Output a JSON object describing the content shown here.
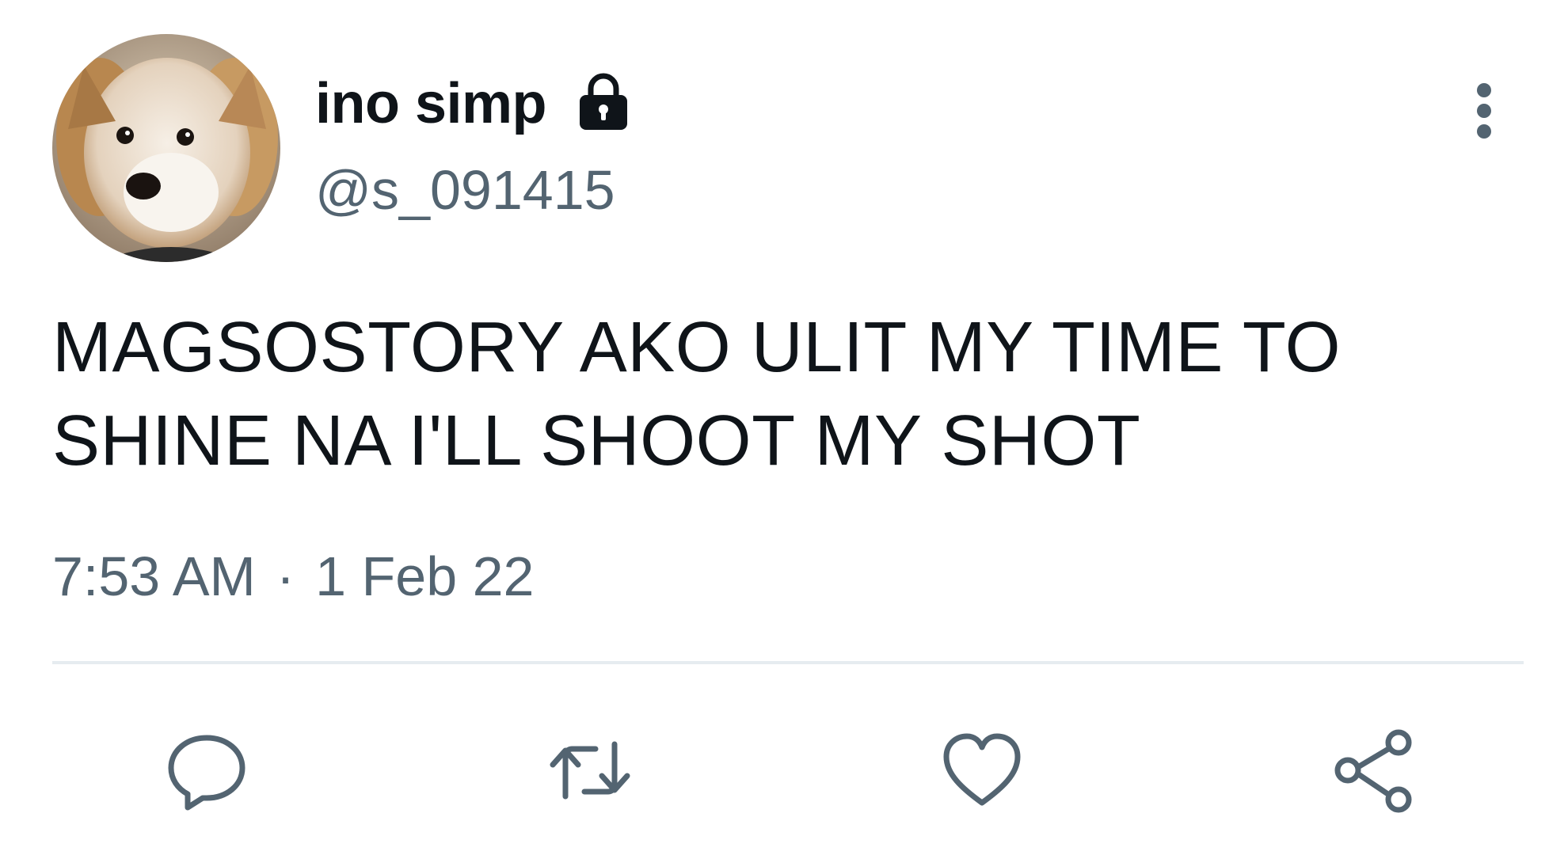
{
  "tweet": {
    "display_name": "ino simp",
    "handle": "@s_091415",
    "text": "MAGSOSTORY AKO ULIT MY TIME TO\nSHINE NA I'LL SHOOT MY SHOT",
    "time": "7:53 AM",
    "separator": "·",
    "date": "1 Feb 22",
    "protected_icon": "lock-icon",
    "avatar": "dog-avatar"
  },
  "actions": [
    {
      "name": "reply",
      "icon": "speech-bubble-icon"
    },
    {
      "name": "retweet",
      "icon": "retweet-icon"
    },
    {
      "name": "like",
      "icon": "heart-icon"
    },
    {
      "name": "share",
      "icon": "share-icon"
    }
  ],
  "colors": {
    "text": "#0f1419",
    "secondary": "#536471",
    "divider": "#e6ecf0",
    "icon": "#536471"
  }
}
